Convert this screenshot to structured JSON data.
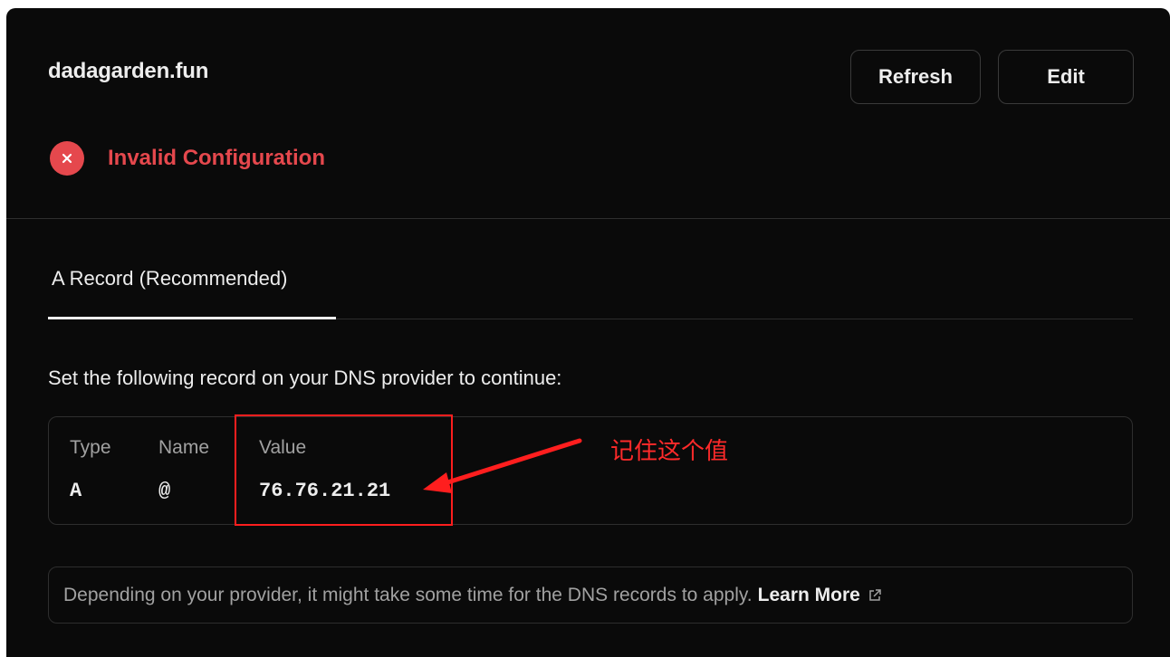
{
  "domain": {
    "name": "dadagarden.fun"
  },
  "actions": {
    "refresh_label": "Refresh",
    "edit_label": "Edit"
  },
  "status": {
    "icon": "close-icon",
    "text": "Invalid Configuration",
    "color": "#e5484d"
  },
  "tabs": [
    {
      "label": "A Record (Recommended)",
      "active": true
    }
  ],
  "instruction": "Set the following record on your DNS provider to continue:",
  "record": {
    "headers": {
      "type": "Type",
      "name": "Name",
      "value": "Value"
    },
    "values": {
      "type": "A",
      "name": "@",
      "value": "76.76.21.21"
    }
  },
  "annotation": {
    "text": "记住这个值",
    "color": "#ff1e1e"
  },
  "note": {
    "text": "Depending on your provider, it might take some time for the DNS records to apply.",
    "link_label": "Learn More",
    "link_icon": "external-link-icon"
  },
  "colors": {
    "background": "#0a0a0a",
    "text": "#ededed",
    "muted": "#a1a1a1",
    "border": "#2e2e2e",
    "error": "#e5484d"
  }
}
